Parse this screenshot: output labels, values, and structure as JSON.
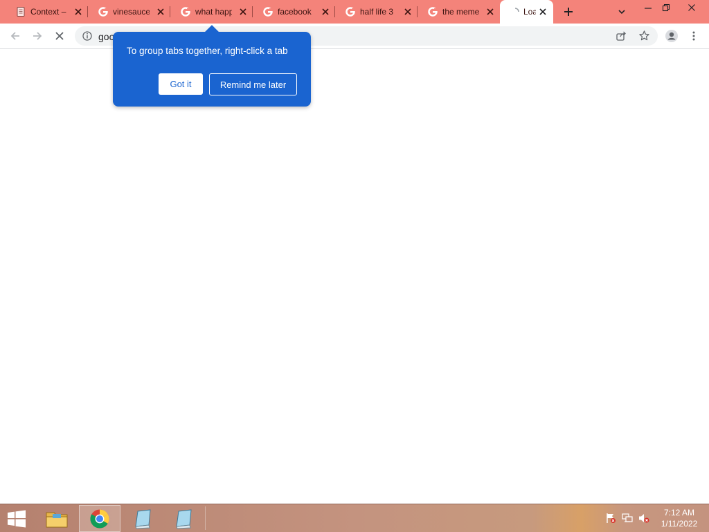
{
  "tabs": [
    {
      "title": "Context –",
      "favicon": "document-icon"
    },
    {
      "title": "vinesauce",
      "favicon": "google-icon"
    },
    {
      "title": "what happ",
      "favicon": "google-icon"
    },
    {
      "title": "facebook",
      "favicon": "google-icon"
    },
    {
      "title": "half life 3",
      "favicon": "google-icon"
    },
    {
      "title": "the meme",
      "favicon": "google-icon"
    },
    {
      "title": "Loa",
      "favicon": "loading-icon",
      "active": true
    }
  ],
  "address_bar": {
    "url": "goo"
  },
  "tab_group_promo": {
    "message": "To group tabs together, right-click a tab",
    "got_it_label": "Got it",
    "remind_label": "Remind me later"
  },
  "taskbar": {
    "apps": [
      "start-button",
      "file-explorer",
      "chrome",
      "notepad",
      "notepad"
    ],
    "clock": {
      "time": "7:12 AM",
      "date": "1/11/2022"
    }
  },
  "colors": {
    "tabstrip": "#f4837a",
    "promo_bubble": "#1a64d0",
    "taskbar": "#c4937f"
  }
}
